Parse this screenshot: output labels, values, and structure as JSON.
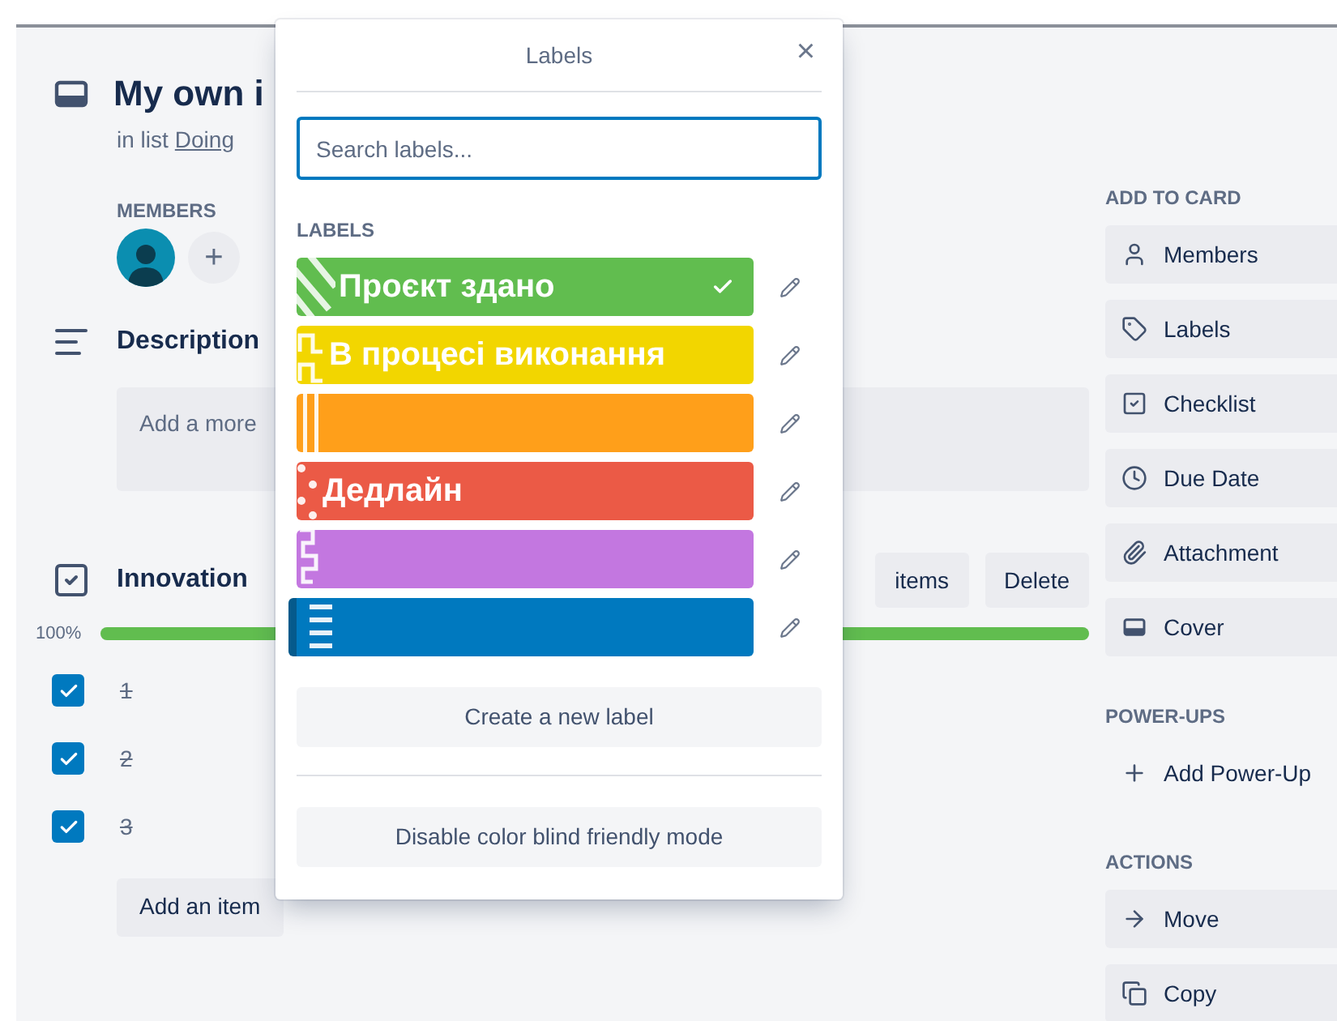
{
  "card": {
    "title": "My own i",
    "list_prefix": "in list",
    "list_name": "Doing",
    "members": {
      "heading": "MEMBERS",
      "add": "+"
    },
    "description": {
      "heading": "Description",
      "placeholder": "Add a more"
    },
    "checklist": {
      "title": "Innovation",
      "buttons": [
        "items",
        "Delete"
      ],
      "percent": "100%",
      "level": 1.0,
      "items": [
        {
          "text": "1",
          "checked": true
        },
        {
          "text": "2",
          "checked": true
        },
        {
          "text": "3",
          "checked": true
        }
      ],
      "add": "Add an item"
    }
  },
  "sidebar": [
    {
      "heading": "ADD TO CARD",
      "buttons": [
        {
          "kind": "user",
          "label": "Members"
        },
        {
          "kind": "tag",
          "label": "Labels"
        },
        {
          "kind": "checklist",
          "label": "Checklist"
        },
        {
          "kind": "clock",
          "label": "Due Date"
        },
        {
          "kind": "clip",
          "label": "Attachment"
        },
        {
          "kind": "cover",
          "label": "Cover"
        }
      ]
    },
    {
      "heading": "POWER-UPS",
      "buttons": [
        {
          "kind": "plus",
          "label": "Add Power-Up"
        }
      ]
    },
    {
      "heading": "ACTIONS",
      "buttons": [
        {
          "kind": "arrow",
          "label": "Move"
        },
        {
          "kind": "copy",
          "label": "Copy"
        }
      ]
    }
  ],
  "popover": {
    "title": "Labels",
    "close": "×",
    "search": {
      "placeholder": "Search labels..."
    },
    "heading": "LABELS",
    "labels": [
      {
        "text": "Проєкт здано",
        "color": "#61bd4f",
        "kind": "stripes",
        "checked": true,
        "focused": false
      },
      {
        "text": "В процесі виконання",
        "color": "#f2d600",
        "kind": "steps",
        "checked": false,
        "focused": false
      },
      {
        "color": "#ff9f1a",
        "kind": "bars",
        "checked": false,
        "focused": false
      },
      {
        "text": "Дедлайн",
        "color": "#eb5a46",
        "kind": "dots",
        "checked": false,
        "focused": false
      },
      {
        "color": "#c377e0",
        "kind": "zigzag",
        "checked": false,
        "focused": false
      },
      {
        "color": "#0079bf",
        "kind": "lines",
        "checked": false,
        "focused": true
      }
    ],
    "create": "Create a new label",
    "colorblind": "Disable color blind friendly mode"
  }
}
